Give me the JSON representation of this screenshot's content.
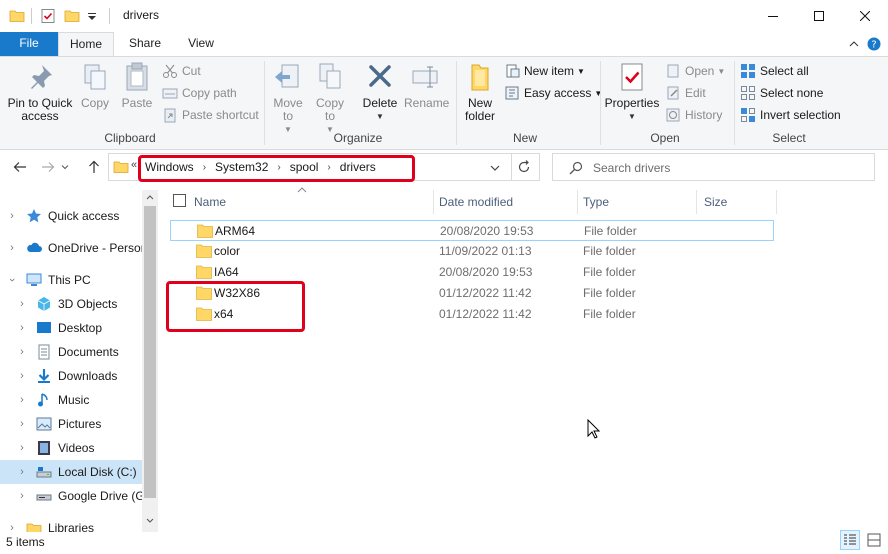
{
  "window": {
    "title": "drivers"
  },
  "ribbon_tabs": [
    "File",
    "Home",
    "Share",
    "View"
  ],
  "ribbon": {
    "clipboard": {
      "label": "Clipboard",
      "pin_label": "Pin to Quick access",
      "copy_label": "Copy",
      "paste_label": "Paste",
      "cut_label": "Cut",
      "copy_path_label": "Copy path",
      "paste_shortcut_label": "Paste shortcut"
    },
    "organize": {
      "label": "Organize",
      "move_to_label": "Move to",
      "copy_to_label": "Copy to",
      "delete_label": "Delete",
      "rename_label": "Rename"
    },
    "new": {
      "label": "New",
      "new_folder_label": "New folder",
      "new_item_label": "New item",
      "easy_access_label": "Easy access"
    },
    "open": {
      "label": "Open",
      "properties_label": "Properties",
      "open_label": "Open",
      "edit_label": "Edit",
      "history_label": "History"
    },
    "select": {
      "label": "Select",
      "select_all_label": "Select all",
      "select_none_label": "Select none",
      "invert_selection_label": "Invert selection"
    }
  },
  "address": {
    "overflow": "«",
    "crumbs": [
      "Windows",
      "System32",
      "spool",
      "drivers"
    ]
  },
  "search": {
    "placeholder": "Search drivers"
  },
  "nav_pane": [
    {
      "label": "Quick access",
      "icon": "star-icon",
      "indent": 0
    },
    {
      "label": "OneDrive - Personal",
      "icon": "cloud-icon",
      "indent": 0
    },
    {
      "label": "This PC",
      "icon": "computer-icon",
      "indent": 0,
      "expanded": true
    },
    {
      "label": "3D Objects",
      "icon": "cube-icon",
      "indent": 1
    },
    {
      "label": "Desktop",
      "icon": "desktop-icon",
      "indent": 1
    },
    {
      "label": "Documents",
      "icon": "document-icon",
      "indent": 1
    },
    {
      "label": "Downloads",
      "icon": "download-icon",
      "indent": 1
    },
    {
      "label": "Music",
      "icon": "music-icon",
      "indent": 1
    },
    {
      "label": "Pictures",
      "icon": "pictures-icon",
      "indent": 1
    },
    {
      "label": "Videos",
      "icon": "video-icon",
      "indent": 1
    },
    {
      "label": "Local Disk (C:)",
      "icon": "disk-icon",
      "indent": 1,
      "selected": true
    },
    {
      "label": "Google Drive (G:)",
      "icon": "drive-icon",
      "indent": 1
    },
    {
      "label": "Libraries",
      "icon": "library-icon",
      "indent": 0
    }
  ],
  "columns": {
    "name": "Name",
    "date": "Date modified",
    "type": "Type",
    "size": "Size"
  },
  "files": [
    {
      "name": "ARM64",
      "date": "20/08/2020 19:53",
      "type": "File folder"
    },
    {
      "name": "color",
      "date": "11/09/2022 01:13",
      "type": "File folder"
    },
    {
      "name": "IA64",
      "date": "20/08/2020 19:53",
      "type": "File folder"
    },
    {
      "name": "W32X86",
      "date": "01/12/2022 11:42",
      "type": "File folder"
    },
    {
      "name": "x64",
      "date": "01/12/2022 11:42",
      "type": "File folder"
    }
  ],
  "status": {
    "item_count": "5 items"
  },
  "colors": {
    "accent": "#1979ca",
    "folder": "#ffd766",
    "highlight": "#e0001b",
    "selection": "#cce4f7"
  }
}
